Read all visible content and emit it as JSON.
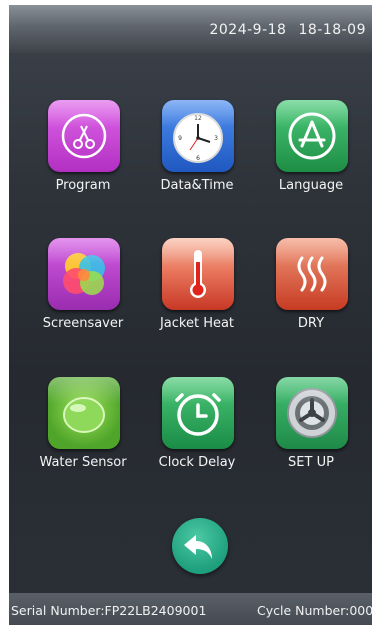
{
  "status_bar": {
    "date": "2024-9-18",
    "time": "18-18-09"
  },
  "menu": [
    {
      "label": "Program",
      "icon": "scissors-icon",
      "color": "#c93fd4"
    },
    {
      "label": "Data&Time",
      "icon": "clock-icon",
      "color": "#2f6fd8"
    },
    {
      "label": "Language",
      "icon": "app-store-icon",
      "color": "#27a35a"
    },
    {
      "label": "Screensaver",
      "icon": "color-swirl-icon",
      "color": "#b53bc8"
    },
    {
      "label": "Jacket Heat",
      "icon": "thermometer-icon",
      "color": "#d8503a"
    },
    {
      "label": "DRY",
      "icon": "steam-icon",
      "color": "#d25030"
    },
    {
      "label": "Water Sensor",
      "icon": "water-drop-icon",
      "color": "#6cc23a"
    },
    {
      "label": "Clock Delay",
      "icon": "alarm-clock-icon",
      "color": "#23a560"
    },
    {
      "label": "SET UP",
      "icon": "settings-gear-icon",
      "color": "#2ea25c"
    }
  ],
  "back_button": {
    "icon": "back-arrow-icon",
    "color": "#1e9f7d"
  },
  "footer": {
    "serial": "Serial Number:FP22LB2409001",
    "cycle": "Cycle Number:000"
  }
}
